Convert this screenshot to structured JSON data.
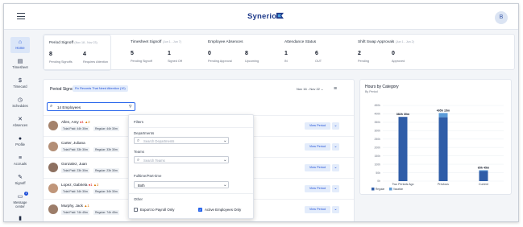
{
  "app": {
    "logo": "Synerion",
    "avatar_initial": "B"
  },
  "colors": {
    "accent": "#1d4ed8",
    "bar_regular": "#2f5da8",
    "bar_vacation": "#5b9bd8",
    "flag_red": "#dc2626",
    "flag_yellow": "#d97706"
  },
  "sidebar": [
    {
      "label": "Home",
      "icon": "home-icon",
      "glyph": "⌂",
      "active": true
    },
    {
      "label": "Timesheet",
      "icon": "timesheet-icon",
      "glyph": "▤"
    },
    {
      "label": "Timecard",
      "icon": "timecard-icon",
      "glyph": "$"
    },
    {
      "label": "Schedules",
      "icon": "clock-icon",
      "glyph": "◷"
    },
    {
      "label": "Absences",
      "icon": "absences-icon",
      "glyph": "✕"
    },
    {
      "label": "Profile",
      "icon": "profile-icon",
      "glyph": "●"
    },
    {
      "label": "Accruals",
      "icon": "accruals-icon",
      "glyph": "≡"
    },
    {
      "label": "Signoff",
      "icon": "signoff-icon",
      "glyph": "✎"
    },
    {
      "label": "Message center",
      "icon": "message-icon",
      "glyph": "▭",
      "badge": "1"
    },
    {
      "label": "",
      "icon": "document-icon",
      "glyph": "▮"
    }
  ],
  "kpis": {
    "period_signoff": {
      "title": "Period Signoff",
      "range": "(Nov 18 - Nov 23)",
      "pending_num": "8",
      "pending_label": "Pending Signoffs",
      "attention_num": "4",
      "attention_label": "Requires Attention"
    },
    "timesheet_signoff": {
      "title": "Timesheet Signoff",
      "range": "(Jun 1 - Jun 7)",
      "pending_num": "5",
      "pending_label": "Pending Signoff",
      "signed_num": "1",
      "signed_label": "Signed Off"
    },
    "absences": {
      "title": "Employee Absences",
      "pending_num": "0",
      "pending_label": "Pending Approval",
      "upcoming_num": "8",
      "upcoming_label": "Upcoming"
    },
    "attendance": {
      "title": "Attendance Status",
      "in_num": "1",
      "in_label": "IN",
      "out_num": "6",
      "out_label": "OUT"
    },
    "shift_swap": {
      "title": "Shift Swap Approvals",
      "range": "(Jun 1 - Jun 2)",
      "pending_num": "2",
      "pending_label": "Pending",
      "approved_num": "0",
      "approved_label": "Approved"
    }
  },
  "period_signoff": {
    "title": "Period Signoff",
    "chip": "Fix Records That Need Attention (10)",
    "date_range": "Nov 16 - Nov 22",
    "search_value": "14 Employees"
  },
  "employees": [
    {
      "name": "Allen, Amy",
      "red": "1",
      "yellow": "2",
      "total": "Total Paid: 44h 30m",
      "regular": "Regular: 44h 30m",
      "view": "View Period"
    },
    {
      "name": "Carter, Juliana",
      "red": "",
      "yellow": "",
      "total": "Total Paid: 33h 30m",
      "regular": "Regular: 33h 30m",
      "view": "View Period"
    },
    {
      "name": "Gonzalez, Juan",
      "red": "",
      "yellow": "",
      "total": "Total Paid: 23h 30m",
      "regular": "Regular: 23h 30m",
      "view": "View Period"
    },
    {
      "name": "Lopez, Gabriela",
      "red": "1",
      "yellow": "2",
      "total": "Total Paid: 34h 30m",
      "regular": "Regular: 34h 30m",
      "view": "View Period"
    },
    {
      "name": "Murphy, Jack",
      "red": "",
      "yellow": "1",
      "total": "Total Paid: 74h 45m",
      "regular": "Regular: 74h 45m",
      "view": "View Period"
    }
  ],
  "filters": {
    "title": "Filters",
    "departments_label": "Departments",
    "departments_placeholder": "Search Departments",
    "teams_label": "Teams",
    "teams_placeholder": "Search Teams",
    "fulltime_label": "Fulltime/Part-time",
    "fulltime_value": "Both",
    "other_label": "Other",
    "export_label": "Export to Payroll Only",
    "export_checked": false,
    "active_label": "Active Employees Only",
    "active_checked": true
  },
  "chart_data": {
    "type": "bar",
    "title": "Hours by Category",
    "subtitle": "By Period",
    "categories": [
      "Two Periods Ago",
      "Previous",
      "Current"
    ],
    "series": [
      {
        "name": "Regular",
        "values": [
          382,
          380,
          60
        ]
      },
      {
        "name": "Vacation",
        "values": [
          0,
          25,
          5
        ]
      }
    ],
    "totals": [
      "382h 30m",
      "405h 15m",
      "65h 45m"
    ],
    "ylim": [
      0,
      450
    ],
    "yticks": [
      0,
      50,
      100,
      150,
      200,
      250,
      300,
      350,
      400,
      450
    ],
    "ytick_labels": [
      "0h",
      "50h",
      "100h",
      "150h",
      "200h",
      "250h",
      "300h",
      "350h",
      "400h",
      "450h"
    ],
    "legend": "bottom-left",
    "stacked": true
  }
}
